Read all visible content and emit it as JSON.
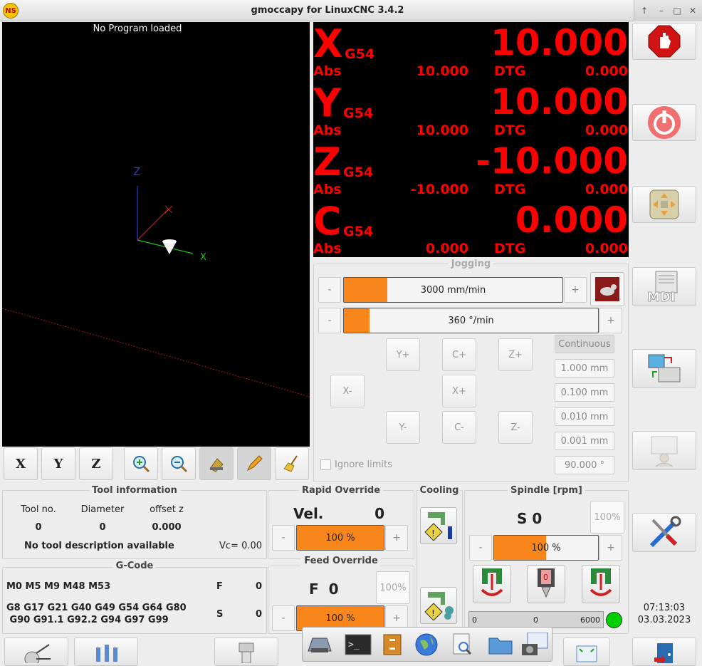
{
  "window": {
    "title": "gmoccapy for LinuxCNC  3.4.2"
  },
  "preview": {
    "title": "No Program loaded",
    "axis_labels": [
      "Z",
      "X"
    ]
  },
  "dro": [
    {
      "axis": "X",
      "system": "G54",
      "value": "10.000",
      "abs_label": "Abs",
      "abs": "10.000",
      "dtg_label": "DTG",
      "dtg": "0.000"
    },
    {
      "axis": "Y",
      "system": "G54",
      "value": "10.000",
      "abs_label": "Abs",
      "abs": "10.000",
      "dtg_label": "DTG",
      "dtg": "0.000"
    },
    {
      "axis": "Z",
      "system": "G54",
      "value": "-10.000",
      "abs_label": "Abs",
      "abs": "-10.000",
      "dtg_label": "DTG",
      "dtg": "0.000"
    },
    {
      "axis": "C",
      "system": "G54",
      "value": "0.000",
      "abs_label": "Abs",
      "abs": "0.000",
      "dtg_label": "DTG",
      "dtg": "0.000"
    }
  ],
  "jogging": {
    "title": "Jogging",
    "linear_speed": "3000 mm/min",
    "linear_fraction": 0.2,
    "angular_speed": "360 °/min",
    "angular_fraction": 0.1,
    "buttons": {
      "y_plus": "Y+",
      "c_plus": "C+",
      "z_plus": "Z+",
      "x_minus": "X-",
      "x_plus": "X+",
      "y_minus": "Y-",
      "c_minus": "C-",
      "z_minus": "Z-"
    },
    "increments": [
      "Continuous",
      "1.000 mm",
      "0.100 mm",
      "0.010 mm",
      "0.001 mm"
    ],
    "angular_increment": "90.000 °",
    "ignore_limits": "Ignore limits",
    "minus": "-",
    "plus": "+"
  },
  "tool": {
    "title": "Tool information",
    "headers": [
      "Tool no.",
      "Diameter",
      "offset z"
    ],
    "values": [
      "0",
      "0",
      "0.000"
    ],
    "description": "No tool description available",
    "vc": "Vc= 0.00"
  },
  "gcode": {
    "title": "G-Code",
    "mcodes": "M0 M5 M9 M48 M53",
    "gcodes_line1": "G8 G17 G21 G40 G49 G54 G64 G80",
    "gcodes_line2": " G90 G91.1 G92.2 G94 G97 G99",
    "f_label": "F",
    "f_value": "0",
    "s_label": "S",
    "s_value": "0"
  },
  "rapid_override": {
    "title": "Rapid Override",
    "vel_label": "Vel.",
    "vel_value": "0",
    "percent": "100 %",
    "fraction": 1.0
  },
  "feed_override": {
    "title": "Feed Override",
    "f_label": "F  0",
    "reset": "100%",
    "percent": "100 %",
    "fraction": 1.0
  },
  "cooling": {
    "title": "Cooling"
  },
  "spindle": {
    "title": "Spindle [rpm]",
    "s_label": "S 0",
    "reset": "100%",
    "percent": "100 %",
    "fraction": 0.5,
    "bar_min": "0",
    "bar_value": "0",
    "bar_max": "6000"
  },
  "clock": {
    "time": "07:13:03",
    "date": "03.03.2023"
  },
  "colors": {
    "dro": "#ff0000",
    "slider": "#f8861a",
    "led": "#00d000"
  }
}
